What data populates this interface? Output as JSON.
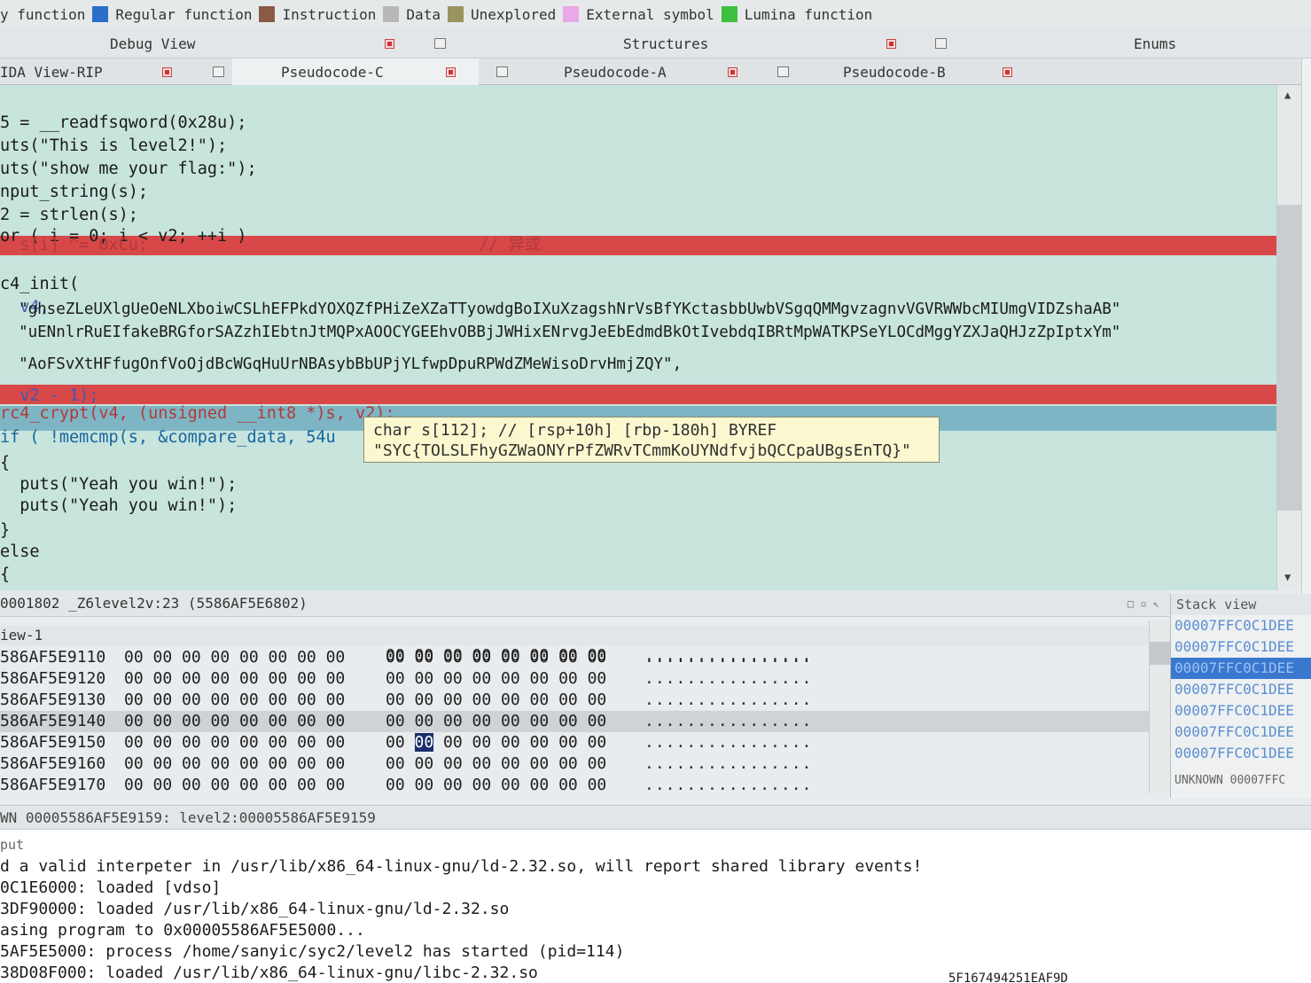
{
  "legend": [
    {
      "label": "y function",
      "color": ""
    },
    {
      "label": "Regular function",
      "color": "#2a6fc9"
    },
    {
      "label": "Instruction",
      "color": "#8a5a44"
    },
    {
      "label": "Data",
      "color": "#b8b8b8"
    },
    {
      "label": "Unexplored",
      "color": "#9a9460"
    },
    {
      "label": "External symbol",
      "color": "#e9a8e8"
    },
    {
      "label": "Lumina function",
      "color": "#3fbf3f"
    }
  ],
  "top_tabs": {
    "debug_view": "Debug View",
    "structures": "Structures",
    "enums": "Enums"
  },
  "sub_tabs": {
    "ida_view": "IDA View-RIP",
    "pseudo_c": "Pseudocode-C",
    "pseudo_a": "Pseudocode-A",
    "pseudo_b": "Pseudocode-B"
  },
  "code": {
    "l01": "5 = __readfsqword(0x28u);",
    "l02": "uts(\"This is level2!\");",
    "l03": "uts(\"show me your flag:\");",
    "l04": "nput_string(s);",
    "l05": "2 = strlen(s);",
    "l06": "or ( i = 0; i < v2; ++i )",
    "l07": "  s[i] ^= 0xCu;",
    "l07_comment": "// 异或",
    "l08": "c4_init(",
    "l09": "  v4,",
    "l10": "  \"ghseZLeUXlgUeOeNLXboiwCSLhEFPkdYOXQZfPHiZeXZaTTyowdgBoIXuXzagshNrVsBfYKctasbbUwbVSgqQMMgvzagnvVGVRWWbcMIUmgVIDZshaAB\"",
    "l11": "  \"uENnlrRuEIfakeBRGforSAZzhIEbtnJtMQPxAOOCYGEEhvOBBjJWHixENrvgJeEbEdmdBkOtIvebdqIBRtMpWATKPSeYLOCdMggYZXJaQHJzZpIptxYm\"",
    "l12": "  \"AoFSvXtHFfugOnfVoOjdBcWGqHuUrNBAsybBbUPjYLfwpDpuRPWdZMeWisoDrvHmjZQY\",",
    "l13": "  v2 - 1);",
    "l14": "rc4_crypt(v4, (unsigned __int8 *)s, v2);",
    "l15": "if ( !memcmp(s, &compare_data, 54u",
    "l16": "{",
    "l17": "  puts(\"Yeah you win!\");",
    "l18": "  puts(\"Yeah you win!\");",
    "l19": "}",
    "l20": "else",
    "l21": "{"
  },
  "tooltip": {
    "line1": "char s[112]; // [rsp+10h] [rbp-180h] BYREF",
    "line2": "\"SYC{TOLSLFhyGZWaONYrPfZWRvTCmmKoUYNdfvjbQCCpaUBgsEnTQ}\""
  },
  "status1": "0001802 _Z6level2v:23 (5586AF5E6802)",
  "hex": {
    "header": "iew-1",
    "rows": [
      {
        "addr": "",
        "b1": "",
        "b2": "00 00 00 00 00 00 00 00",
        "ascii": "................"
      },
      {
        "addr": "586AF5E9110",
        "b1": "00 00 00 00 00 00 00 00",
        "b2": "00 00 00 00 00 00 00 00",
        "ascii": "................"
      },
      {
        "addr": "586AF5E9120",
        "b1": "00 00 00 00 00 00 00 00",
        "b2": "00 00 00 00 00 00 00 00",
        "ascii": "................"
      },
      {
        "addr": "586AF5E9130",
        "b1": "00 00 00 00 00 00 00 00",
        "b2": "00 00 00 00 00 00 00 00",
        "ascii": "................"
      },
      {
        "addr": "586AF5E9140",
        "b1": "00 00 00 00 00 00 00 00",
        "b2": "00 00 00 00 00 00 00 00",
        "ascii": "................"
      },
      {
        "addr": "586AF5E9150",
        "b1": "00 00 00 00 00 00 00 00",
        "b2": "00 00 00 00 00 00 00 00",
        "ascii": "................"
      },
      {
        "addr": "586AF5E9160",
        "b1": "00 00 00 00 00 00 00 00",
        "b2": "00 00 00 00 00 00 00 00",
        "ascii": "................"
      },
      {
        "addr": "586AF5E9170",
        "b1": "00 00 00 00 00 00 00 00",
        "b2": "00 00 00 00 00 00 00 00",
        "ascii": "................"
      }
    ],
    "selected_byte": "00"
  },
  "stack": {
    "title": "Stack view",
    "rows": [
      "00007FFC0C1DEE",
      "00007FFC0C1DEE",
      "00007FFC0C1DEE",
      "00007FFC0C1DEE",
      "00007FFC0C1DEE",
      "00007FFC0C1DEE",
      "00007FFC0C1DEE"
    ],
    "footer": "UNKNOWN 00007FFC"
  },
  "status2": "WN 00005586AF5E9159: level2:00005586AF5E9159",
  "output": {
    "header": "put",
    "lines": [
      "d a valid interpeter in /usr/lib/x86_64-linux-gnu/ld-2.32.so, will report shared library events!",
      "0C1E6000: loaded [vdso]",
      "3DF90000: loaded /usr/lib/x86_64-linux-gnu/ld-2.32.so",
      "asing program to 0x00005586AF5E5000...",
      "5AF5E5000: process /home/sanyic/syc2/level2 has started (pid=114)",
      "38D08F000: loaded /usr/lib/x86_64-linux-gnu/libc-2.32.so",
      "5F167494251EAF9D"
    ]
  }
}
